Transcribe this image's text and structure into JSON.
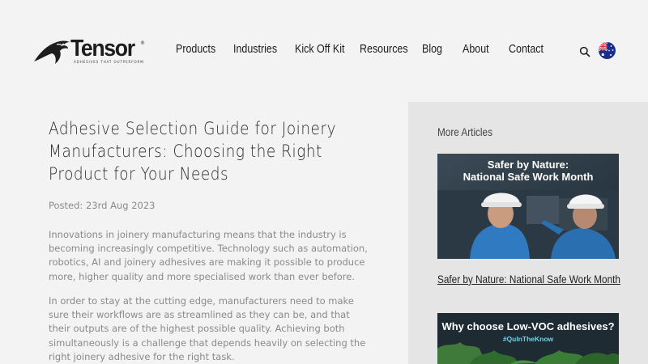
{
  "header": {
    "logo_text": "Tensor",
    "logo_reg": "®",
    "logo_tagline": "ADHESIVES THAT OUTPERFORM"
  },
  "nav": {
    "items": [
      "Products",
      "Industries",
      "Kick Off Kit",
      "Resources",
      "Blog",
      "About",
      "Contact"
    ]
  },
  "article": {
    "title": "Adhesive Selection Guide for Joinery Manufacturers: Choosing the Right Product for Your Needs",
    "posted": "Posted: 23rd Aug 2023",
    "paragraphs": [
      "Innovations in joinery manufacturing means that the industry is becoming increasingly competitive. Technology such as automation, robotics, AI and joinery adhesives are making it possible to produce more, higher quality and more specialised work than ever before.",
      "In order to stay at the cutting edge, manufacturers need to make sure their workflows are as streamlined as they can be, and that their outputs are of the highest possible quality. Achieving both simultaneously is a challenge that depends heavily on selecting the right joinery adhesive for the right task."
    ]
  },
  "sidebar": {
    "heading": "More Articles",
    "articles": [
      {
        "image_line1": "Safer by Nature:",
        "image_line2": "National Safe Work Month",
        "title": "Safer by Nature: National Safe Work Month"
      },
      {
        "image_line1": "Why choose Low-VOC adhesives?",
        "image_tag": "#QuInTheKnow"
      }
    ]
  },
  "colors": {
    "page_bg": "#f3f3f3",
    "sidebar_bg": "#e5e5e5",
    "text_dark": "#1d1d1d",
    "text_muted": "#8a8a8a"
  }
}
